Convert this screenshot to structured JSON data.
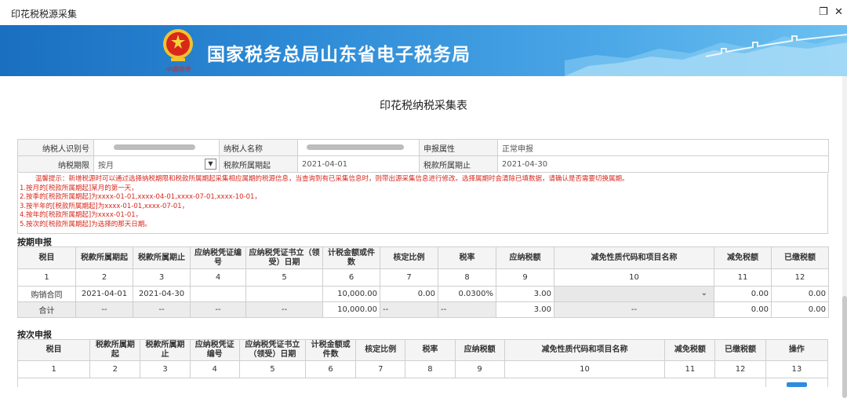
{
  "window": {
    "title": "印花税税源采集",
    "restore_glyph": "❐",
    "close_glyph": "✕"
  },
  "banner": {
    "title": "国家税务总局山东省电子税务局",
    "emblem_caption": "中国税务",
    "colors": {
      "left": "#1a6fc0",
      "right": "#6cc0f0"
    }
  },
  "page_title": "印花税纳税采集表",
  "info": {
    "taxpayer_id_label": "纳税人识别号",
    "taxpayer_name_label": "纳税人名称",
    "report_attr_label": "申报属性",
    "report_attr_value": "正常申报",
    "tax_period_label": "纳税期限",
    "tax_period_value": "按月",
    "period_start_label": "税款所属期起",
    "period_start_value": "2021-04-01",
    "period_end_label": "税款所属期止",
    "period_end_value": "2021-04-30"
  },
  "notice": {
    "lines": [
      "温馨提示：新增税源时可以通过选择纳税期限和税款所属期起采集相应属期的税源信息，当查询到有已采集信息时，则带出源采集信息进行修改。选择属期时会清除已填数据，请确认是否需要切换属期。",
      "1.按月的[税款所属期起]某月的第一天，",
      "2.按季的[税款所属期起]为xxxx-01-01,xxxx-04-01,xxxx-07-01,xxxx-10-01，",
      "3.按半年的[税款所属期起]为xxxx-01-01,xxxx-07-01，",
      "4.按年的[税款所属期起]为xxxx-01-01，",
      "5.按次的[税款所属期起]为选择的那天日期。"
    ]
  },
  "periodic": {
    "section_title": "按期申报",
    "headers": [
      "税目",
      "税款所属期起",
      "税款所属期止",
      "应纳税凭证编号",
      "应纳税凭证书立（领受）日期",
      "计税金额或件数",
      "核定比例",
      "税率",
      "应纳税额",
      "减免性质代码和项目名称",
      "减免税额",
      "已缴税额"
    ],
    "numbers": [
      "1",
      "2",
      "3",
      "4",
      "5",
      "6",
      "7",
      "8",
      "9",
      "10",
      "11",
      "12"
    ],
    "row": [
      "购销合同",
      "2021-04-01",
      "2021-04-30",
      "",
      "",
      "10,000.00",
      "0.00",
      "0.0300%",
      "3.00",
      "",
      "0.00",
      "0.00"
    ],
    "total": [
      "合计",
      "--",
      "--",
      "--",
      "--",
      "10,000.00",
      "--",
      "--",
      "3.00",
      "--",
      "0.00",
      "0.00"
    ]
  },
  "per_time": {
    "section_title": "按次申报",
    "headers": [
      "税目",
      "税款所属期起",
      "税款所属期止",
      "应纳税凭证编号",
      "应纳税凭证书立（领受）日期",
      "计税金额或件数",
      "核定比例",
      "税率",
      "应纳税额",
      "减免性质代码和项目名称",
      "减免税额",
      "已缴税额",
      "操作"
    ],
    "numbers": [
      "1",
      "2",
      "3",
      "4",
      "5",
      "6",
      "7",
      "8",
      "9",
      "10",
      "11",
      "12",
      "13"
    ]
  }
}
